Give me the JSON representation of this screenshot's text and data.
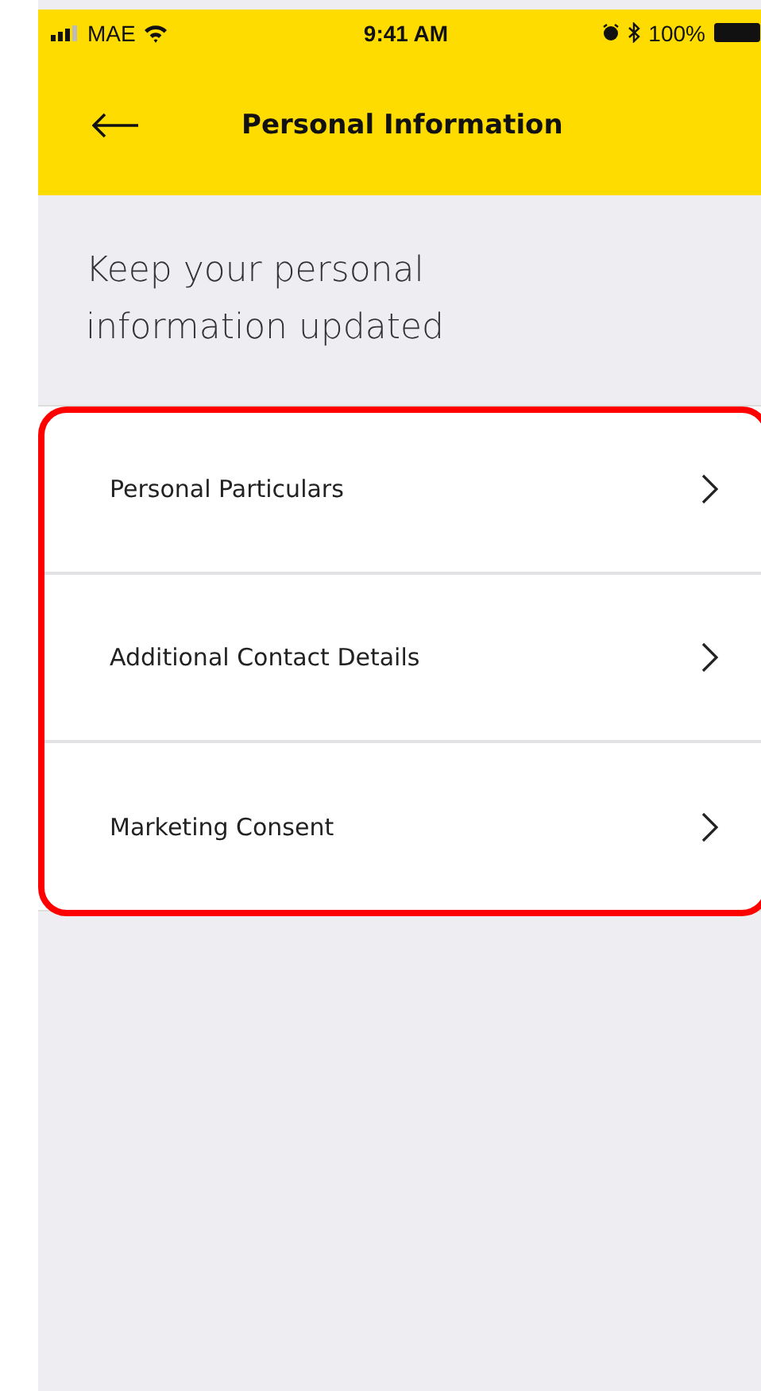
{
  "status_bar": {
    "carrier": "MAE",
    "time": "9:41 AM",
    "battery": "100%"
  },
  "header": {
    "title": "Personal Information"
  },
  "intro": "Keep your personal information updated",
  "menu": {
    "highlighted": true,
    "items": [
      {
        "label": "Personal Particulars"
      },
      {
        "label": "Additional Contact Details"
      },
      {
        "label": "Marketing Consent"
      }
    ]
  }
}
